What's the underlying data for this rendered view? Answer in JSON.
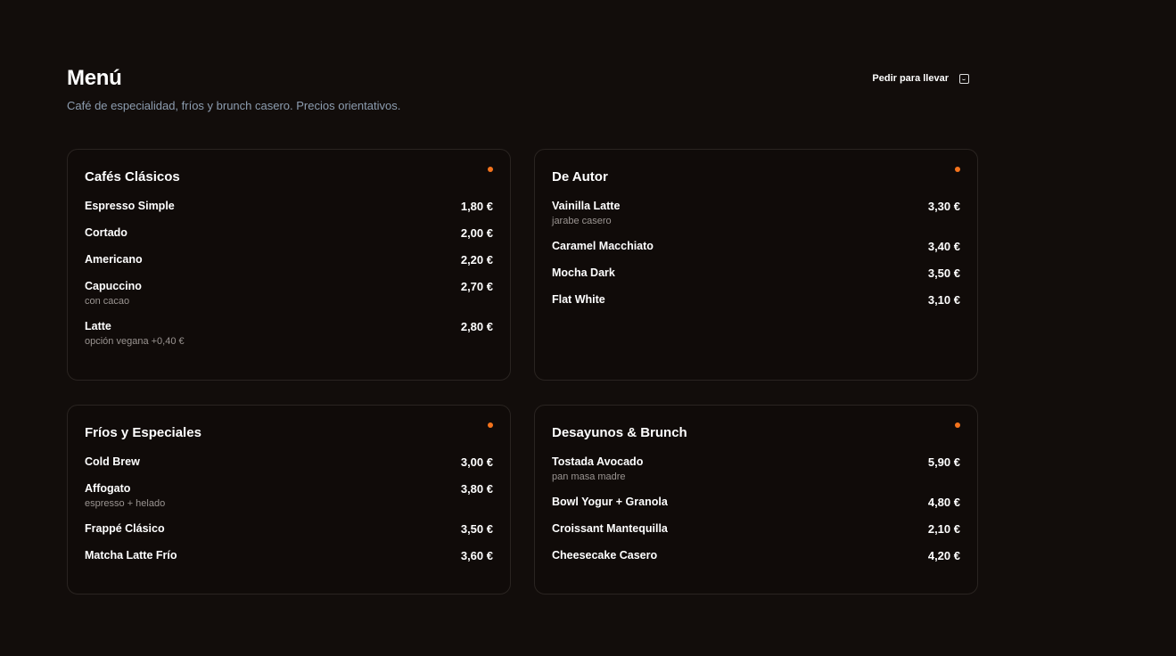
{
  "header": {
    "title": "Menú",
    "subtitle": "Café de especialidad, fríos y brunch casero. Precios orientativos.",
    "order_label": "Pedir para llevar"
  },
  "accent": "#f4731c",
  "sections": [
    {
      "title": "Cafés Clásicos",
      "items": [
        {
          "name": "Espresso Simple",
          "price": "1,80 €"
        },
        {
          "name": "Cortado",
          "price": "2,00 €"
        },
        {
          "name": "Americano",
          "price": "2,20 €"
        },
        {
          "name": "Capuccino",
          "note": "con cacao",
          "price": "2,70 €"
        },
        {
          "name": "Latte",
          "note": "opción vegana +0,40 €",
          "price": "2,80 €"
        }
      ]
    },
    {
      "title": "De Autor",
      "items": [
        {
          "name": "Vainilla Latte",
          "note": "jarabe casero",
          "price": "3,30 €"
        },
        {
          "name": "Caramel Macchiato",
          "price": "3,40 €"
        },
        {
          "name": "Mocha Dark",
          "price": "3,50 €"
        },
        {
          "name": "Flat White",
          "price": "3,10 €"
        }
      ]
    },
    {
      "title": "Fríos y Especiales",
      "items": [
        {
          "name": "Cold Brew",
          "price": "3,00 €"
        },
        {
          "name": "Affogato",
          "note": "espresso + helado",
          "price": "3,80 €"
        },
        {
          "name": "Frappé Clásico",
          "price": "3,50 €"
        },
        {
          "name": "Matcha Latte Frío",
          "price": "3,60 €"
        }
      ]
    },
    {
      "title": "Desayunos & Brunch",
      "items": [
        {
          "name": "Tostada Avocado",
          "note": "pan masa madre",
          "price": "5,90 €"
        },
        {
          "name": "Bowl Yogur + Granola",
          "price": "4,80 €"
        },
        {
          "name": "Croissant Mantequilla",
          "price": "2,10 €"
        },
        {
          "name": "Cheesecake Casero",
          "price": "4,20 €"
        }
      ]
    }
  ]
}
